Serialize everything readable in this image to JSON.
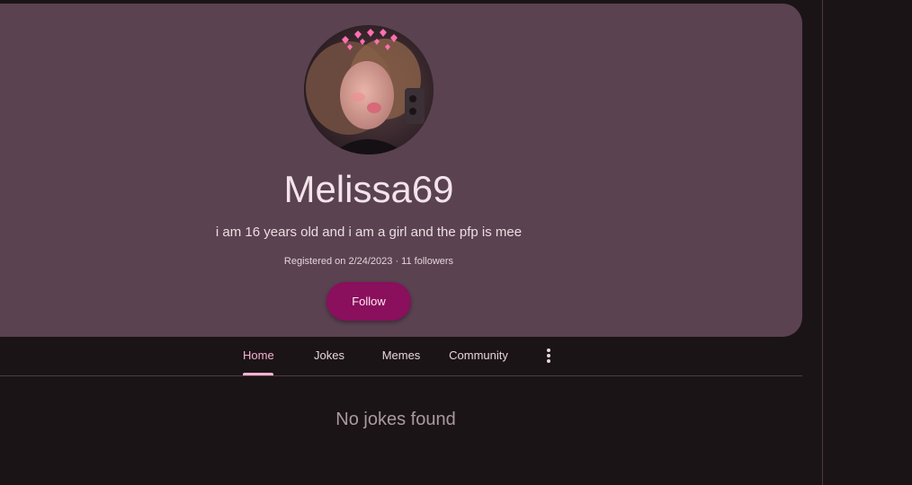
{
  "profile": {
    "username": "Melissa69",
    "bio": "i am 16 years old and i am a girl and the pfp is mee",
    "meta": "Registered on 2/24/2023 · 11 followers",
    "follow_label": "Follow",
    "avatar_icon": "avatar-photo"
  },
  "tabs": [
    {
      "label": "Home",
      "active": true
    },
    {
      "label": "Jokes",
      "active": false
    },
    {
      "label": "Memes",
      "active": false
    },
    {
      "label": "Community",
      "active": false
    }
  ],
  "more_icon": "more-vertical-icon",
  "empty_state": "No jokes found",
  "colors": {
    "background": "#1b1416",
    "card": "#5a4250",
    "accent": "#8a0f5d",
    "active_tab": "#f7b2d4"
  }
}
